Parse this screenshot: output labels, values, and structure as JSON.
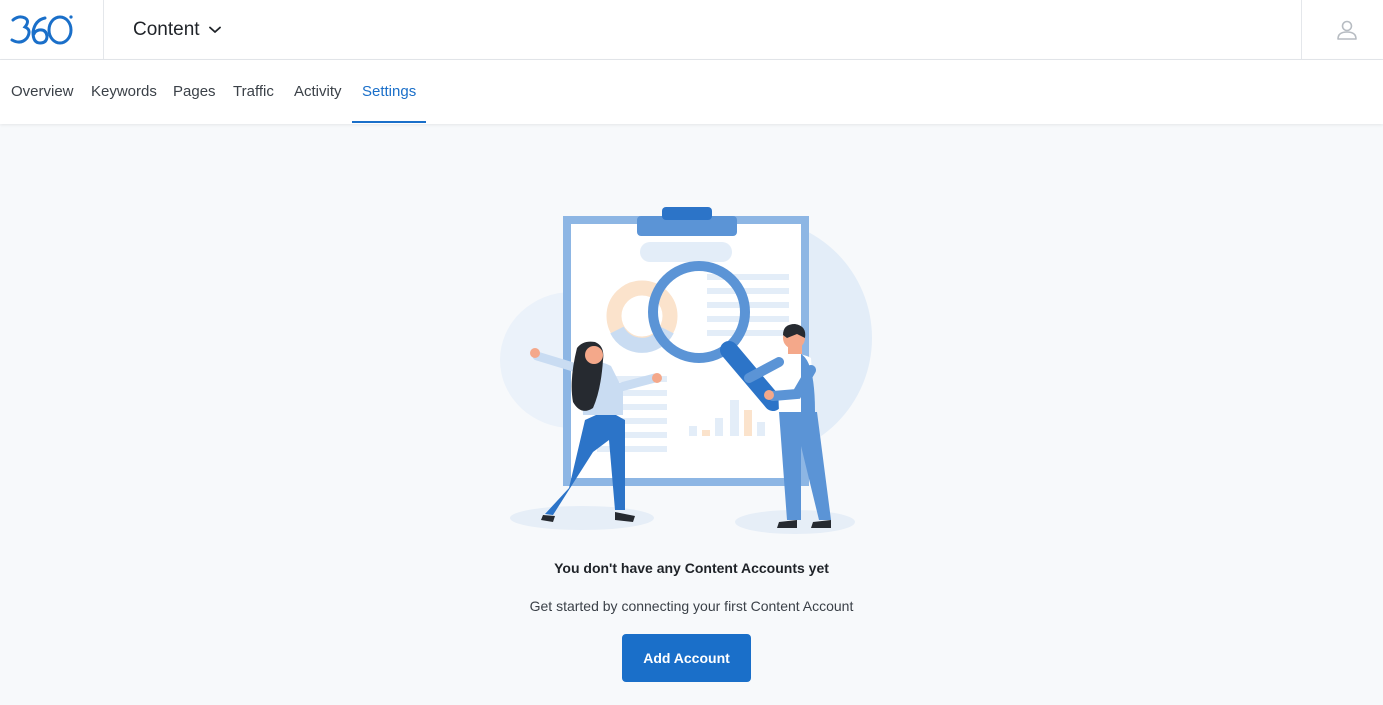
{
  "header": {
    "logo_alt": "360",
    "product_name": "Content",
    "icons": {
      "logo": "360-logo",
      "chevron": "chevron-down-icon",
      "user": "user-icon"
    }
  },
  "tabs": [
    {
      "label": "Overview",
      "active": false
    },
    {
      "label": "Keywords",
      "active": false
    },
    {
      "label": "Pages",
      "active": false
    },
    {
      "label": "Traffic",
      "active": false
    },
    {
      "label": "Activity",
      "active": false
    },
    {
      "label": "Settings",
      "active": true
    }
  ],
  "empty_state": {
    "title": "You don't have any Content Accounts yet",
    "subtitle": "Get started by connecting your first Content Account",
    "button_label": "Add Account"
  },
  "colors": {
    "accent": "#1a6fc9",
    "background": "#f7f9fb",
    "text": "#1f2328"
  }
}
